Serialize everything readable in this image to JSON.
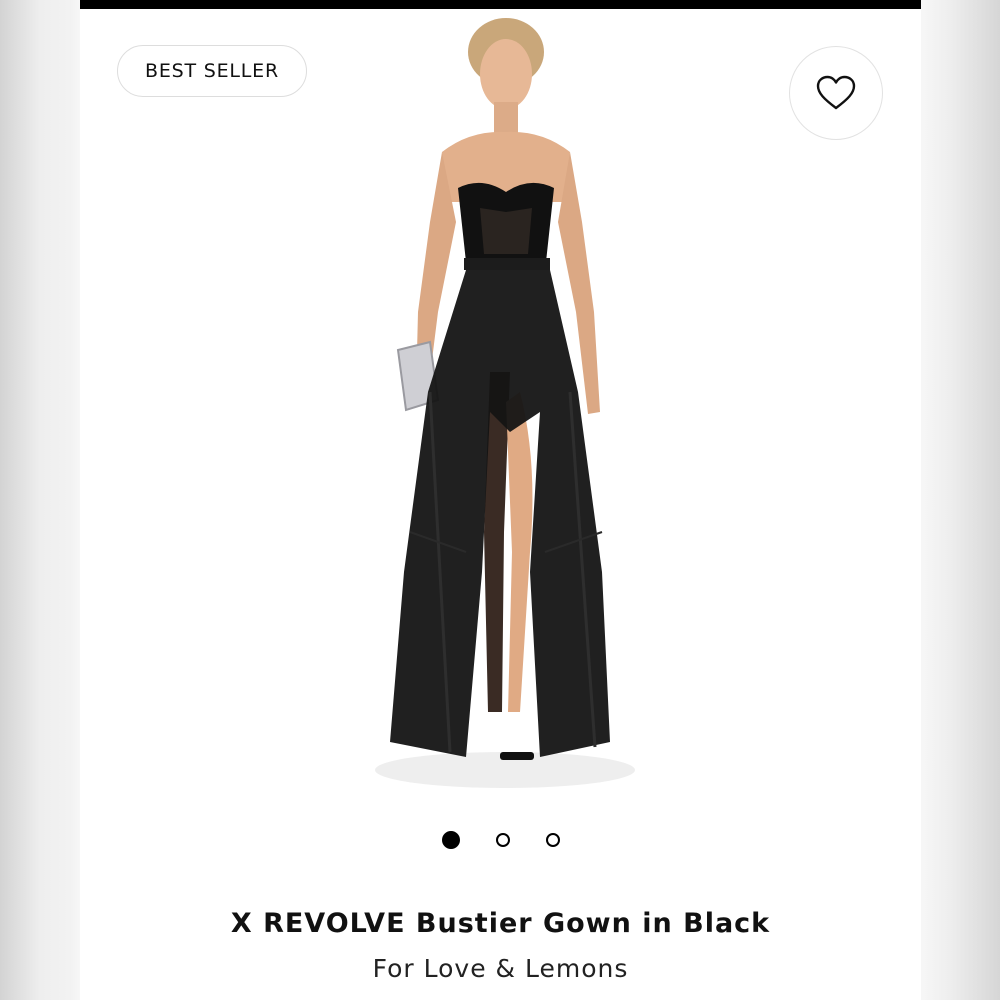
{
  "badge": {
    "label": "BEST SELLER"
  },
  "wishlist": {
    "icon": "heart-icon"
  },
  "product_image": {
    "icon": "product-photo-model-black-gown"
  },
  "carousel": {
    "dot_count": 3,
    "active_index": 0
  },
  "product": {
    "title": "X REVOLVE Bustier Gown in Black",
    "brand": "For Love & Lemons"
  },
  "colors": {
    "accent": "#000000",
    "background": "#ffffff"
  }
}
